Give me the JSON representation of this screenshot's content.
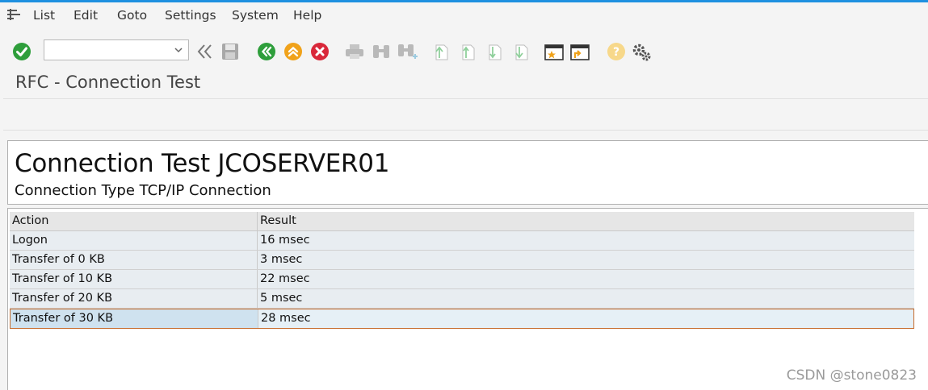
{
  "menu": {
    "items": [
      "List",
      "Edit",
      "Goto",
      "Settings",
      "System",
      "Help"
    ]
  },
  "toolbar": {
    "command_field_value": "",
    "icons": [
      "check-icon",
      "back-double-icon",
      "save-icon",
      "back-icon",
      "exit-icon",
      "cancel-icon",
      "print-icon",
      "find-icon",
      "find-next-icon",
      "first-page-icon",
      "prev-page-icon",
      "next-page-icon",
      "last-page-icon",
      "new-session-icon",
      "shortcut-icon",
      "help-icon",
      "settings-icon"
    ]
  },
  "page": {
    "title": "RFC - Connection Test"
  },
  "header": {
    "title": "Connection Test JCOSERVER01",
    "subtitle": "Connection Type TCP/IP Connection"
  },
  "table": {
    "columns": [
      "Action",
      "Result"
    ],
    "rows": [
      [
        "Logon",
        "16 msec"
      ],
      [
        "Transfer of 0 KB",
        "3 msec"
      ],
      [
        "Transfer of 10 KB",
        "22 msec"
      ],
      [
        "Transfer of 20 KB",
        "5 msec"
      ],
      [
        "Transfer of 30 KB",
        "28 msec"
      ]
    ]
  },
  "watermark": "CSDN @stone0823",
  "colors": {
    "accent_line": "#1e90e0",
    "selected_row_border": "#c56a2a",
    "ok_green": "#2e9e3b",
    "cancel_red": "#d9283a",
    "warn_orange": "#f0a21a"
  }
}
